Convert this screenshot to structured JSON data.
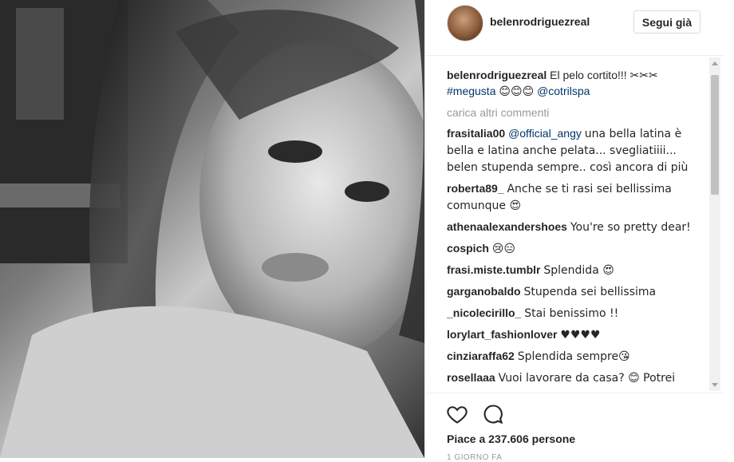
{
  "post": {
    "photo_alt": "Black and white selfie",
    "author": "belenrodriguezreal",
    "follow_label": "Segui già",
    "caption": {
      "user": "belenrodriguezreal",
      "text": "El pelo cortito!!! ✂✂✂",
      "hashtag": "#megusta",
      "emojis": "😊😊😊",
      "mention": "@cotrilspa"
    },
    "load_more": "carica altri commenti",
    "comments": [
      {
        "user": "frasitalia00",
        "mention": "@official_angy",
        "text": "una bella latina è bella e latina anche pelata... svegliatiiii... belen stupenda sempre.. così ancora di più"
      },
      {
        "user": "roberta89_",
        "mention": "",
        "text": "Anche se ti rasi sei bellissima comunque 😍"
      },
      {
        "user": "athenaalexandershoes",
        "mention": "",
        "text": "You're so pretty dear!"
      },
      {
        "user": "cospich",
        "mention": "",
        "text": "😢😑"
      },
      {
        "user": "frasi.miste.tumblr",
        "mention": "",
        "text": "Splendida 😍"
      },
      {
        "user": "garganobaldo",
        "mention": "",
        "text": "Stupenda sei bellissima"
      },
      {
        "user": "_nicolecirillo_",
        "mention": "",
        "text": "Stai benissimo !!"
      },
      {
        "user": "lorylart_fashionlover",
        "mention": "",
        "text": "♥♥♥♥"
      },
      {
        "user": "cinziaraffa62",
        "mention": "",
        "text": "Splendida sempre😘"
      },
      {
        "user": "rosellaaa",
        "mention": "",
        "text": "Vuoi lavorare da casa? 😊 Potrei"
      }
    ],
    "icons": {
      "like": "heart-icon",
      "comment": "comment-icon"
    },
    "likes_text": "Piace a 237.606 persone",
    "time_ago": "1 GIORNO FA"
  }
}
